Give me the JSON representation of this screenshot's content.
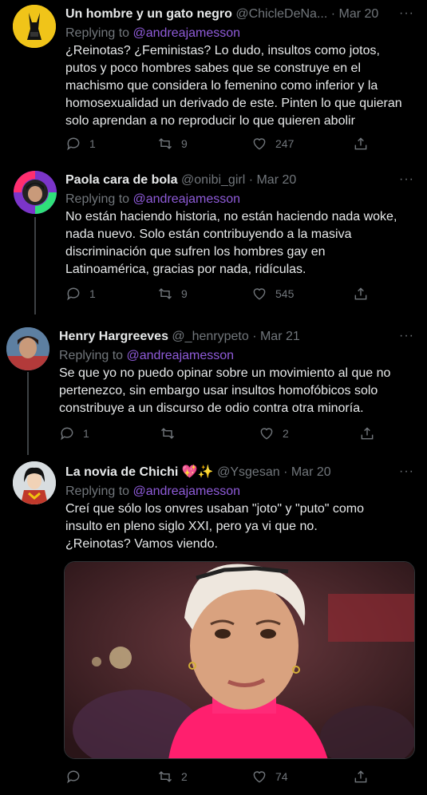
{
  "tweets": [
    {
      "name": "Un hombre y un gato negro",
      "handle": "@ChicleDeNa...",
      "date": "· Mar 20",
      "replying_prefix": "Replying to",
      "replying_to": "@andreajamesson",
      "text_lines": [
        "¿Reinotas? ¿Feministas? Lo dudo, insultos como jotos,",
        "putos y poco hombres sabes que se construye en el",
        "machismo que considera lo femenino como inferior y la",
        "homosexualidad un derivado de este. Pinten lo que quieran",
        "solo aprendan a no reproducir lo que quieren abolir"
      ],
      "replies": "1",
      "retweets": "9",
      "likes": "247"
    },
    {
      "name": "Paola cara de bola",
      "handle": "@onibi_girl",
      "date": "· Mar 20",
      "replying_prefix": "Replying to",
      "replying_to": "@andreajamesson",
      "text_lines": [
        "No están haciendo historia, no están haciendo nada woke,",
        "nada nuevo. Solo están contribuyendo a la masiva",
        "discriminación que sufren los hombres gay en",
        "Latinoamérica, gracias por nada, ridículas."
      ],
      "replies": "1",
      "retweets": "9",
      "likes": "545"
    },
    {
      "name": "Henry Hargreeves",
      "handle": "@_henrypeto",
      "date": "· Mar 21",
      "replying_prefix": "Replying to",
      "replying_to": "@andreajamesson",
      "text_lines": [
        "Se que yo no puedo opinar sobre un movimiento al que no",
        "pertenezco, sin embargo usar insultos homofóbicos solo",
        "constribuye a un discurso de odio contra otra minoría."
      ],
      "replies": "1",
      "retweets": "",
      "likes": "2"
    },
    {
      "name": "La novia de Chichi",
      "name_emoji": "💖✨",
      "handle": "@Ysgesan",
      "date": "· Mar 20",
      "replying_prefix": "Replying to",
      "replying_to": "@andreajamesson",
      "text_lines": [
        "Creí que sólo los onvres usaban \"joto\" y \"puto\" como",
        "insulto en pleno siglo XXI, pero ya vi que no.",
        "¿Reinotas? Vamos viendo."
      ],
      "replies": "",
      "retweets": "2",
      "likes": "74"
    }
  ],
  "more_label": "···",
  "icons": [
    "reply-icon",
    "retweet-icon",
    "like-icon",
    "share-icon"
  ]
}
